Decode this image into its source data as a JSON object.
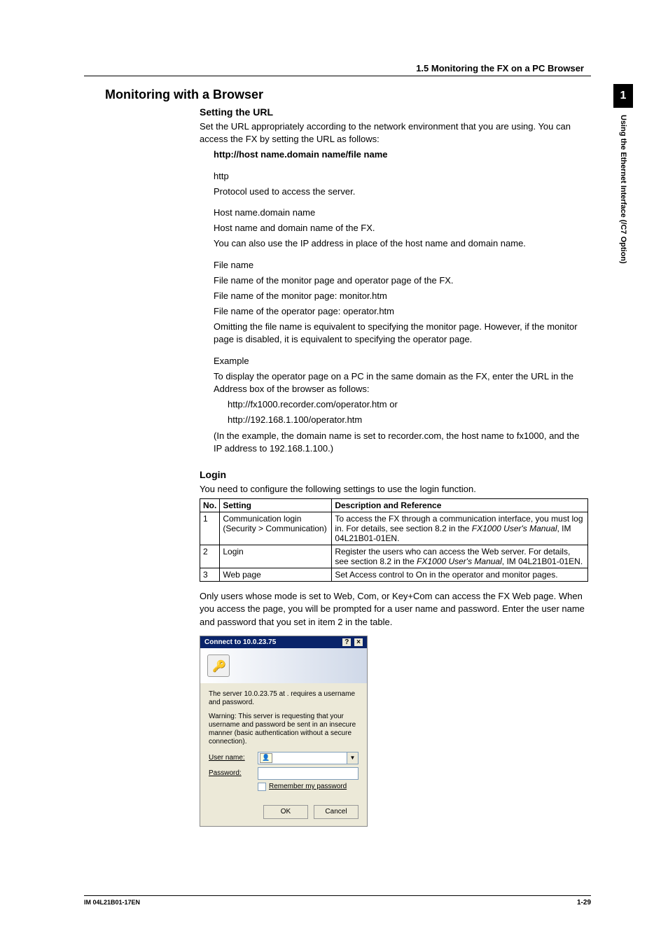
{
  "sideTab": {
    "number": "1",
    "text": "Using the Ethernet Interface (/C7 Option)"
  },
  "header": "1.5  Monitoring the FX on a PC Browser",
  "h1": "Monitoring with a Browser",
  "settingUrl": {
    "title": "Setting the URL",
    "intro": "Set the URL appropriately according to the network environment that you are using. You can access the FX by setting the URL as follows:",
    "urlFormat": "http://host name.domain name/file name",
    "httpLabel": "http",
    "httpDesc": "Protocol used to access the server.",
    "hostLabel": "Host name.domain name",
    "hostDesc1": "Host name and domain name of the FX.",
    "hostDesc2": "You can also use the IP address in place of the host name and domain name.",
    "fileLabel": "File name",
    "fileDesc1": "File name of the monitor page and operator page of the FX.",
    "fileDesc2": "File name of the monitor page: monitor.htm",
    "fileDesc3": "File name of the operator page: operator.htm",
    "fileDesc4": "Omitting the file name is equivalent to specifying the monitor page. However, if the monitor page is disabled, it is equivalent to specifying the operator page.",
    "exLabel": "Example",
    "exDesc1": "To display the operator page on a PC in the same domain as the FX, enter the URL in the Address box of the browser as follows:",
    "exUrl1": "http://fx1000.recorder.com/operator.htm or",
    "exUrl2": "http://192.168.1.100/operator.htm",
    "exDesc2": "(In the example, the domain name is set to recorder.com, the host name to fx1000, and the IP address to 192.168.1.100.)"
  },
  "login": {
    "title": "Login",
    "intro": "You need to configure the following settings to use the login function.",
    "tableHeaders": {
      "c1": "No.",
      "c2": "Setting",
      "c3": "Description and Reference"
    },
    "rows": [
      {
        "no": "1",
        "setting": "Communication login (Security > Communication)",
        "desc_pre": "To access the FX through a communication interface, you must log in. For details, see section 8.2 in the ",
        "desc_italic": "FX1000 User's Manual",
        "desc_post": ", IM 04L21B01-01EN."
      },
      {
        "no": "2",
        "setting": "Login",
        "desc_pre": "Register the users who can access the Web server. For details, see section 8.2 in the ",
        "desc_italic": "FX1000 User's Manual",
        "desc_post": ", IM 04L21B01-01EN."
      },
      {
        "no": "3",
        "setting": "Web page",
        "desc_pre": "Set Access control to On in the operator and monitor pages.",
        "desc_italic": "",
        "desc_post": ""
      }
    ],
    "afterTable": "Only users whose mode is set to Web, Com, or Key+Com can access the FX Web page. When you access the page, you will be prompted for a user name and password. Enter the user name and password that you set in item 2 in the table."
  },
  "dialog": {
    "title": "Connect to 10.0.23.75",
    "help": "?",
    "close": "×",
    "line1": "The server 10.0.23.75 at . requires a username and password.",
    "line2": "Warning: This server is requesting that your username and password be sent in an insecure manner (basic authentication without a secure connection).",
    "userLabel": "User name:",
    "passLabel": "Password:",
    "remember": "Remember my password",
    "ok": "OK",
    "cancel": "Cancel"
  },
  "footer": {
    "left": "IM 04L21B01-17EN",
    "right": "1-29"
  }
}
